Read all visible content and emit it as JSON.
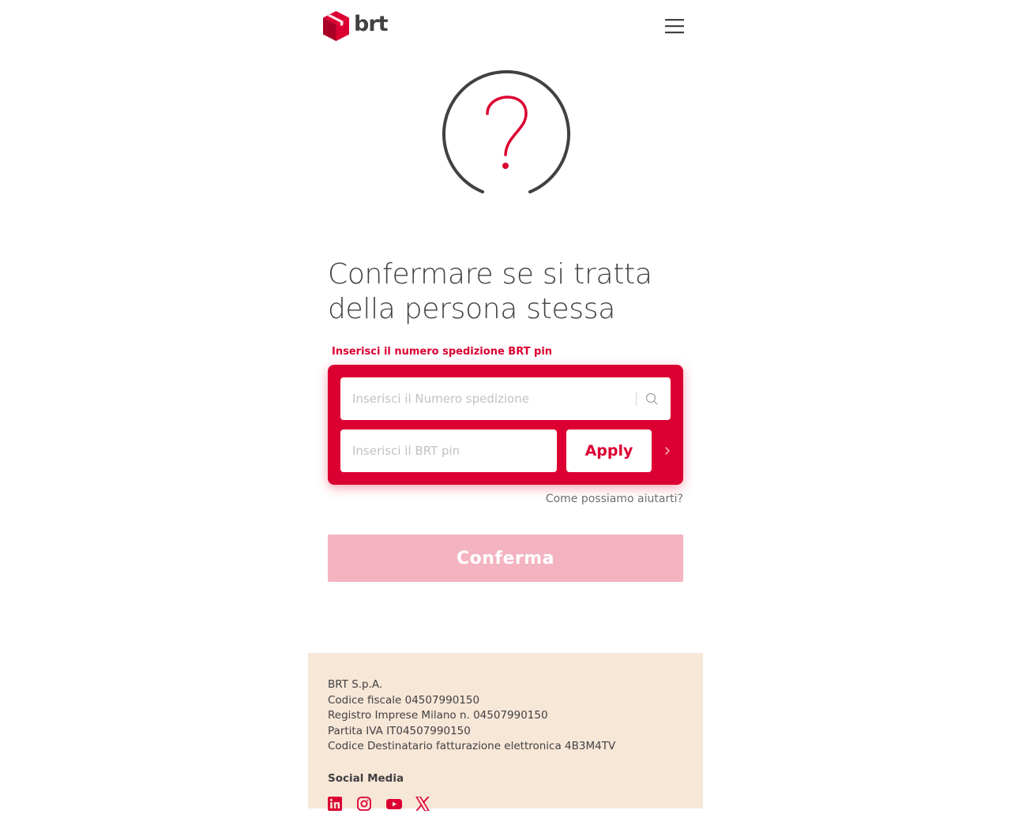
{
  "header": {
    "logo_text": "brt",
    "brand_color": "#dc0032",
    "menu_icon": "hamburger-menu-icon"
  },
  "illustration": {
    "icon": "question-circle-icon"
  },
  "main": {
    "heading": "Confermare se si tratta della persona stessa",
    "field_label": "Inserisci il numero spedizione BRT pin",
    "shipment_input": {
      "placeholder": "Inserisci il Numero spedizione",
      "value": ""
    },
    "pin_input": {
      "placeholder": "Inserisci il BRT pin",
      "value": ""
    },
    "apply_label": "Apply",
    "help_link": "Come possiamo aiutarti?",
    "confirm_label": "Conferma"
  },
  "footer": {
    "company_lines": [
      "BRT S.p.A.",
      "Codice fiscale 04507990150",
      "Registro Imprese Milano n. 04507990150",
      "Partita IVA IT04507990150",
      "Codice Destinatario fatturazione elettronica 4B3M4TV"
    ],
    "social_title": "Social Media",
    "social_icons": [
      "linkedin-icon",
      "instagram-icon",
      "youtube-icon",
      "x-icon"
    ]
  },
  "colors": {
    "accent": "#dc0032",
    "disabled_button": "#f3b3c1",
    "footer_bg": "#f7e7d7",
    "text": "#414042"
  }
}
